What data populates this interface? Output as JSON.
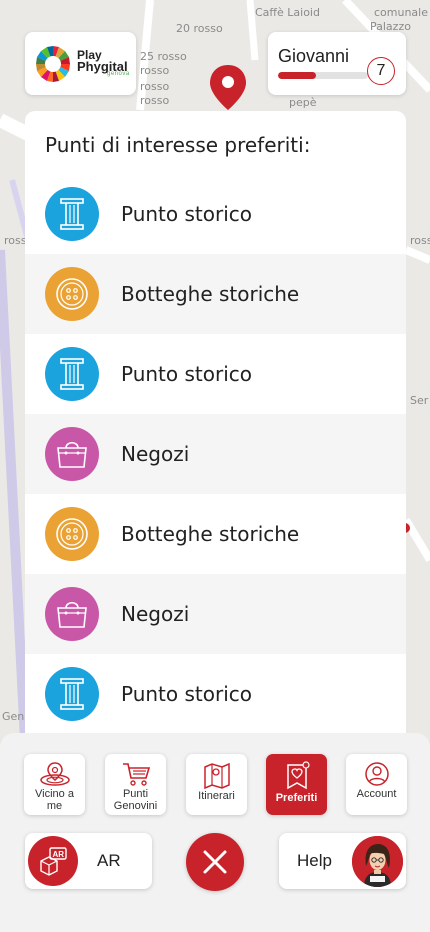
{
  "map": {
    "labels": [
      "Caffè Laioid",
      "comunale",
      "Palazzo",
      "20 rosso",
      "25 rosso",
      "rosso",
      "rosso",
      "rosso",
      "rosso",
      "pepè",
      "rosso",
      "Ser",
      "Gen"
    ]
  },
  "brand": {
    "logo_line1": "Play",
    "logo_line2": "Phygital",
    "logo_line3": "genova"
  },
  "user": {
    "name": "Giovanni",
    "level": "7",
    "progress": 0.42
  },
  "panel": {
    "title": "Punti di interesse preferiti:",
    "items": [
      {
        "label": "Punto storico",
        "icon": "column-icon",
        "color": "#1aa3dc"
      },
      {
        "label": "Botteghe storiche",
        "icon": "button-icon",
        "color": "#eba234"
      },
      {
        "label": "Punto storico",
        "icon": "column-icon",
        "color": "#1aa3dc"
      },
      {
        "label": "Negozi",
        "icon": "bag-icon",
        "color": "#c957a8"
      },
      {
        "label": "Botteghe storiche",
        "icon": "button-icon",
        "color": "#eba234"
      },
      {
        "label": "Negozi",
        "icon": "bag-icon",
        "color": "#c957a8"
      },
      {
        "label": "Punto storico",
        "icon": "column-icon",
        "color": "#1aa3dc"
      }
    ]
  },
  "nav": {
    "items": [
      {
        "label": "Vicino a me",
        "icon": "location-icon",
        "active": false
      },
      {
        "label": "Punti Genovini",
        "icon": "cart-icon",
        "active": false
      },
      {
        "label": "Itinerari",
        "icon": "map-icon",
        "active": false
      },
      {
        "label": "Preferiti",
        "icon": "heart-tag-icon",
        "active": true
      },
      {
        "label": "Account",
        "icon": "user-icon",
        "active": false
      }
    ],
    "ar_label": "AR",
    "help_label": "Help"
  },
  "colors": {
    "accent": "#c8232b",
    "historic": "#1aa3dc",
    "shops": "#eba234",
    "stores": "#c957a8"
  }
}
